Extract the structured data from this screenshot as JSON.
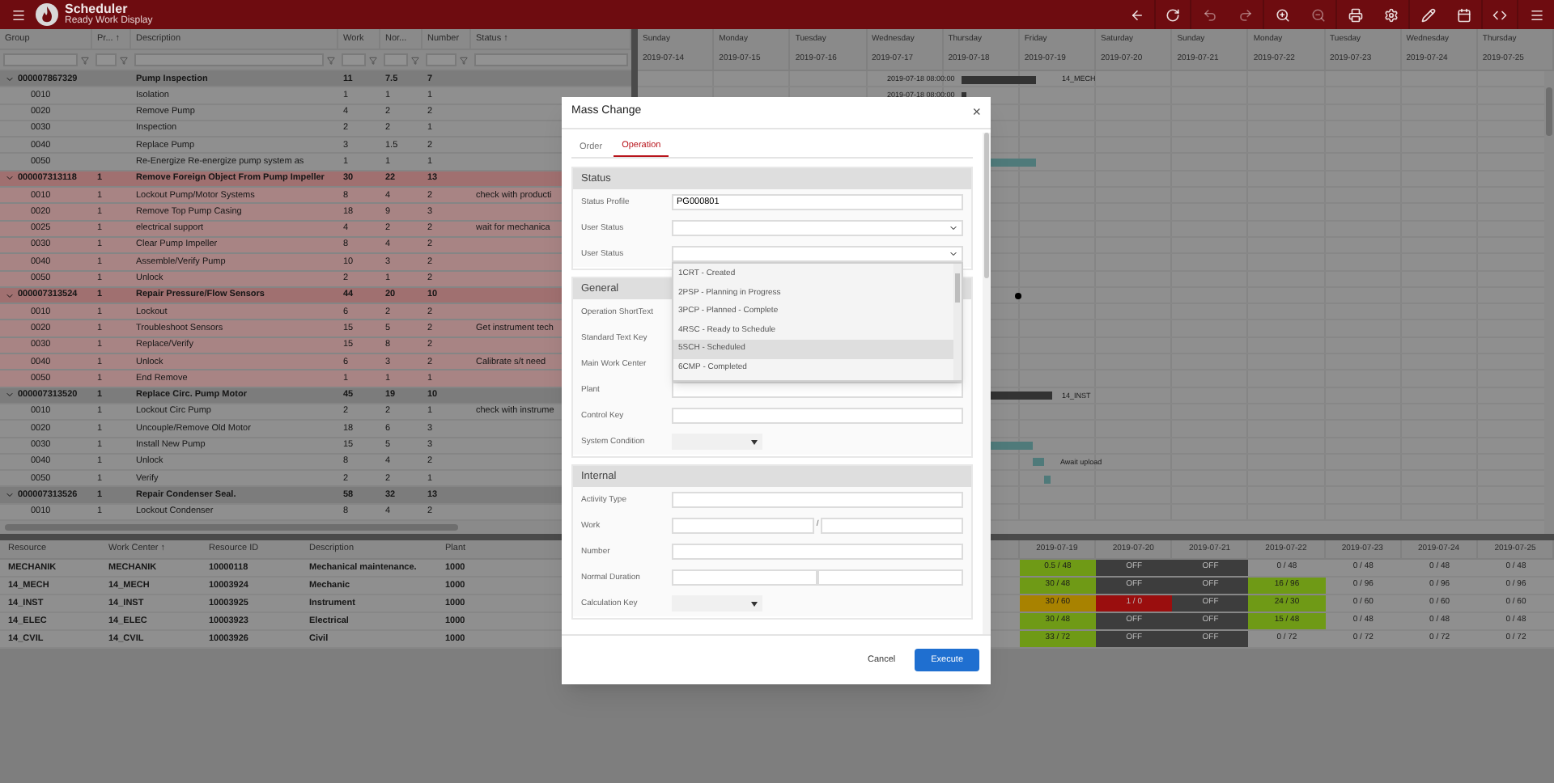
{
  "app": {
    "title": "Scheduler",
    "subtitle": "Ready Work Display"
  },
  "orders_table": {
    "columns": [
      "Group",
      "Pr... ↑",
      "Description",
      "Work",
      "Nor...",
      "Number",
      "Status ↑"
    ],
    "groups": [
      {
        "order": "000007867329",
        "description": "Pump Inspection",
        "work": "11",
        "normal": "7.5",
        "number": "7",
        "highlight": false,
        "expanded": true,
        "operations": [
          {
            "op": "0010",
            "description": "Isolation",
            "work": "1",
            "normal": "1",
            "number": "1"
          },
          {
            "op": "0020",
            "description": "Remove Pump",
            "work": "4",
            "normal": "2",
            "number": "2"
          },
          {
            "op": "0030",
            "description": "Inspection",
            "work": "2",
            "normal": "2",
            "number": "1"
          },
          {
            "op": "0040",
            "description": "Replace Pump",
            "work": "3",
            "normal": "1.5",
            "number": "2"
          },
          {
            "op": "0050",
            "description": "Re-Energize Re-energize pump system as",
            "work": "1",
            "normal": "1",
            "number": "1"
          }
        ]
      },
      {
        "order": "000007313118",
        "priority": "1",
        "description": "Remove Foreign Object From Pump Impeller",
        "work": "30",
        "normal": "22",
        "number": "13",
        "highlight": true,
        "expanded": true,
        "operations": [
          {
            "op": "0010",
            "priority": "1",
            "description": "Lockout Pump/Motor Systems",
            "work": "8",
            "normal": "4",
            "number": "2",
            "status": "check with producti"
          },
          {
            "op": "0020",
            "priority": "1",
            "description": "Remove Top Pump Casing",
            "work": "18",
            "normal": "9",
            "number": "3"
          },
          {
            "op": "0025",
            "priority": "1",
            "description": "electrical support",
            "work": "4",
            "normal": "2",
            "number": "2",
            "status": "wait for mechanica"
          },
          {
            "op": "0030",
            "priority": "1",
            "description": "Clear Pump Impeller",
            "work": "8",
            "normal": "4",
            "number": "2"
          },
          {
            "op": "0040",
            "priority": "1",
            "description": "Assemble/Verify Pump",
            "work": "10",
            "normal": "3",
            "number": "2"
          },
          {
            "op": "0050",
            "priority": "1",
            "description": "Unlock",
            "work": "2",
            "normal": "1",
            "number": "2"
          }
        ]
      },
      {
        "order": "000007313524",
        "priority": "1",
        "description": "Repair Pressure/Flow Sensors",
        "work": "44",
        "normal": "20",
        "number": "10",
        "highlight": true,
        "expanded": true,
        "operations": [
          {
            "op": "0010",
            "priority": "1",
            "description": "Lockout",
            "work": "6",
            "normal": "2",
            "number": "2"
          },
          {
            "op": "0020",
            "priority": "1",
            "description": "Troubleshoot Sensors",
            "work": "15",
            "normal": "5",
            "number": "2",
            "status": "Get instrument tech"
          },
          {
            "op": "0030",
            "priority": "1",
            "description": "Replace/Verify",
            "work": "15",
            "normal": "8",
            "number": "2"
          },
          {
            "op": "0040",
            "priority": "1",
            "description": "Unlock",
            "work": "6",
            "normal": "3",
            "number": "2",
            "status": "Calibrate s/t need"
          },
          {
            "op": "0050",
            "priority": "1",
            "description": "End Remove",
            "work": "1",
            "normal": "1",
            "number": "1"
          }
        ]
      },
      {
        "order": "000007313520",
        "priority": "1",
        "description": "Replace Circ. Pump Motor",
        "work": "45",
        "normal": "19",
        "number": "10",
        "highlight": false,
        "expanded": true,
        "operations": [
          {
            "op": "0010",
            "priority": "1",
            "description": "Lockout Circ Pump",
            "work": "2",
            "normal": "2",
            "number": "1",
            "status": "check with instrume"
          },
          {
            "op": "0020",
            "priority": "1",
            "description": "Uncouple/Remove Old Motor",
            "work": "18",
            "normal": "6",
            "number": "3"
          },
          {
            "op": "0030",
            "priority": "1",
            "description": "Install New Pump",
            "work": "15",
            "normal": "5",
            "number": "3"
          },
          {
            "op": "0040",
            "priority": "1",
            "description": "Unlock",
            "work": "8",
            "normal": "4",
            "number": "2"
          },
          {
            "op": "0050",
            "priority": "1",
            "description": "Verify",
            "work": "2",
            "normal": "2",
            "number": "1"
          }
        ]
      },
      {
        "order": "000007313526",
        "priority": "1",
        "description": "Repair Condenser Seal.",
        "work": "58",
        "normal": "32",
        "number": "13",
        "highlight": false,
        "expanded": true,
        "operations": [
          {
            "op": "0010",
            "priority": "1",
            "description": "Lockout Condenser",
            "work": "8",
            "normal": "4",
            "number": "2"
          }
        ]
      }
    ]
  },
  "gantt": {
    "days": [
      {
        "day": "Sunday",
        "date": "2019-07-14"
      },
      {
        "day": "Monday",
        "date": "2019-07-15"
      },
      {
        "day": "Tuesday",
        "date": "2019-07-16"
      },
      {
        "day": "Wednesday",
        "date": "2019-07-17"
      },
      {
        "day": "Thursday",
        "date": "2019-07-18"
      },
      {
        "day": "Friday",
        "date": "2019-07-19"
      },
      {
        "day": "Saturday",
        "date": "2019-07-20"
      },
      {
        "day": "Sunday",
        "date": "2019-07-21"
      },
      {
        "day": "Monday",
        "date": "2019-07-22"
      },
      {
        "day": "Tuesday",
        "date": "2019-07-23"
      },
      {
        "day": "Wednesday",
        "date": "2019-07-24"
      },
      {
        "day": "Thursday",
        "date": "2019-07-25"
      }
    ],
    "labels": [
      "2019-07-18 08:00:00",
      "14_MECH",
      "2019-07-18 08:00:00",
      "14_INST",
      "Await upload"
    ]
  },
  "resources_table": {
    "columns": [
      "Resource",
      "Work Center ↑",
      "Resource ID",
      "Description",
      "Plant"
    ],
    "dates": [
      "2019-07-19",
      "2019-07-20",
      "2019-07-21",
      "2019-07-22",
      "2019-07-23",
      "2019-07-24",
      "2019-07-25"
    ],
    "rows": [
      {
        "resource": "MECHANIK",
        "work_center": "MECHANIK",
        "resource_id": "10000118",
        "description": "Mechanical maintenance.",
        "plant": "1000",
        "capacity": [
          {
            "text": "0.5 / 48",
            "color": "#6f9a16"
          },
          {
            "text": "OFF",
            "color": "#3d3d3d"
          },
          {
            "text": "OFF",
            "color": "#3d3d3d"
          },
          {
            "text": "0 / 48",
            "color": "#8f8f8f"
          },
          {
            "text": "0 / 48",
            "color": "#8f8f8f"
          },
          {
            "text": "0 / 48",
            "color": "#8f8f8f"
          },
          {
            "text": "0 / 48",
            "color": "#8f8f8f"
          }
        ]
      },
      {
        "resource": "14_MECH",
        "work_center": "14_MECH",
        "resource_id": "10003924",
        "description": "Mechanic",
        "plant": "1000",
        "capacity": [
          {
            "text": "30 / 48",
            "color": "#6f9a16"
          },
          {
            "text": "OFF",
            "color": "#3d3d3d"
          },
          {
            "text": "OFF",
            "color": "#3d3d3d"
          },
          {
            "text": "16 / 96",
            "color": "#6f9a16"
          },
          {
            "text": "0 / 96",
            "color": "#8f8f8f"
          },
          {
            "text": "0 / 96",
            "color": "#8f8f8f"
          },
          {
            "text": "0 / 96",
            "color": "#8f8f8f"
          }
        ]
      },
      {
        "resource": "14_INST",
        "work_center": "14_INST",
        "resource_id": "10003925",
        "description": "Instrument",
        "plant": "1000",
        "capacity": [
          {
            "text": "30 / 60",
            "color": "#a88200"
          },
          {
            "text": "1 / 0",
            "color": "#9a0e0e"
          },
          {
            "text": "OFF",
            "color": "#3d3d3d"
          },
          {
            "text": "24 / 30",
            "color": "#6f9a16"
          },
          {
            "text": "0 / 60",
            "color": "#8f8f8f"
          },
          {
            "text": "0 / 60",
            "color": "#8f8f8f"
          },
          {
            "text": "0 / 60",
            "color": "#8f8f8f"
          }
        ]
      },
      {
        "resource": "14_ELEC",
        "work_center": "14_ELEC",
        "resource_id": "10003923",
        "description": "Electrical",
        "plant": "1000",
        "capacity": [
          {
            "text": "30 / 48",
            "color": "#6f9a16"
          },
          {
            "text": "OFF",
            "color": "#3d3d3d"
          },
          {
            "text": "OFF",
            "color": "#3d3d3d"
          },
          {
            "text": "15 / 48",
            "color": "#6f9a16"
          },
          {
            "text": "0 / 48",
            "color": "#8f8f8f"
          },
          {
            "text": "0 / 48",
            "color": "#8f8f8f"
          },
          {
            "text": "0 / 48",
            "color": "#8f8f8f"
          }
        ]
      },
      {
        "resource": "14_CVIL",
        "work_center": "14_CVIL",
        "resource_id": "10003926",
        "description": "Civil",
        "plant": "1000",
        "capacity": [
          {
            "text": "33 / 72",
            "color": "#6f9a16"
          },
          {
            "text": "OFF",
            "color": "#3d3d3d"
          },
          {
            "text": "OFF",
            "color": "#3d3d3d"
          },
          {
            "text": "0 / 72",
            "color": "#8f8f8f"
          },
          {
            "text": "0 / 72",
            "color": "#8f8f8f"
          },
          {
            "text": "0 / 72",
            "color": "#8f8f8f"
          },
          {
            "text": "0 / 72",
            "color": "#8f8f8f"
          }
        ]
      }
    ]
  },
  "dialog": {
    "title": "Mass Change",
    "close": "×",
    "tabs": [
      {
        "label": "Order",
        "selected": false
      },
      {
        "label": "Operation",
        "selected": true
      }
    ],
    "sections": [
      {
        "title": "Status",
        "fields": [
          {
            "kind": "text",
            "label": "Status Profile",
            "value": "PG000801"
          },
          {
            "kind": "select",
            "label": "User Status"
          },
          {
            "kind": "select",
            "label": "User Status",
            "open": true
          }
        ]
      },
      {
        "title": "General",
        "fields": [
          {
            "kind": "text",
            "label": "Operation ShortText"
          },
          {
            "kind": "text",
            "label": "Standard Text Key"
          },
          {
            "kind": "text",
            "label": "Main Work Center"
          },
          {
            "kind": "text",
            "label": "Plant"
          },
          {
            "kind": "text",
            "label": "Control Key"
          },
          {
            "kind": "small-select",
            "label": "System Condition"
          }
        ]
      },
      {
        "title": "Internal",
        "fields": [
          {
            "kind": "text",
            "label": "Activity Type"
          },
          {
            "kind": "split",
            "label": "Work",
            "separator": "/"
          },
          {
            "kind": "text",
            "label": "Number"
          },
          {
            "kind": "double",
            "label": "Normal Duration"
          },
          {
            "kind": "small-select",
            "label": "Calculation Key"
          }
        ]
      }
    ],
    "dropdown_options": [
      {
        "label": "1CRT - Created",
        "highlighted": false
      },
      {
        "label": "2PSP - Planning in Progress",
        "highlighted": false
      },
      {
        "label": "3PCP - Planned - Complete",
        "highlighted": false
      },
      {
        "label": "4RSC - Ready to Schedule",
        "highlighted": false
      },
      {
        "label": "5SCH - Scheduled",
        "highlighted": true
      },
      {
        "label": "6CMP - Completed",
        "highlighted": false
      }
    ],
    "buttons": [
      {
        "label": "Cancel",
        "kind": "secondary"
      },
      {
        "label": "Execute",
        "kind": "primary"
      }
    ]
  }
}
